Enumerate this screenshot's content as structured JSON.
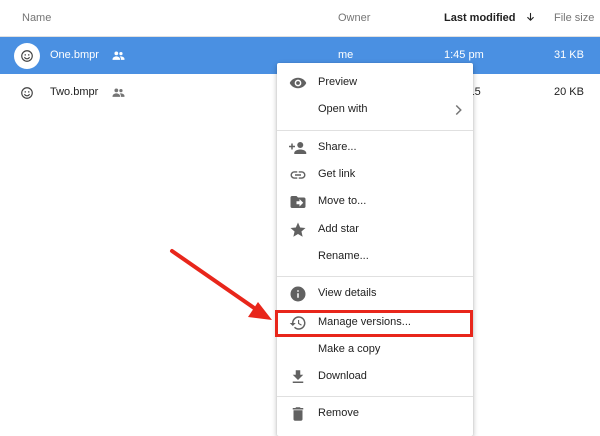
{
  "columns": {
    "name": "Name",
    "owner": "Owner",
    "last_modified": "Last modified",
    "file_size": "File size",
    "sort_icon": "arrow-down-icon"
  },
  "files": [
    {
      "name": "One.bmpr",
      "owner": "me",
      "modified": "1:45 pm",
      "size": "31 KB",
      "selected": true,
      "icon": "smiley-file-icon",
      "shared_icon": "people-icon"
    },
    {
      "name": "Two.bmpr",
      "owner": "",
      "modified": "7, 2015",
      "size": "20 KB",
      "selected": false,
      "icon": "smiley-file-icon",
      "shared_icon": "people-icon"
    }
  ],
  "context_menu": {
    "preview": "Preview",
    "open_with": "Open with",
    "share": "Share...",
    "get_link": "Get link",
    "move_to": "Move to...",
    "add_star": "Add star",
    "rename": "Rename...",
    "view_details": "View details",
    "manage_versions": "Manage versions...",
    "make_copy": "Make a copy",
    "download": "Download",
    "remove": "Remove"
  },
  "colors": {
    "selected_row": "#4a90e2",
    "annotation": "#e8261b",
    "icon_gray": "#616161"
  }
}
